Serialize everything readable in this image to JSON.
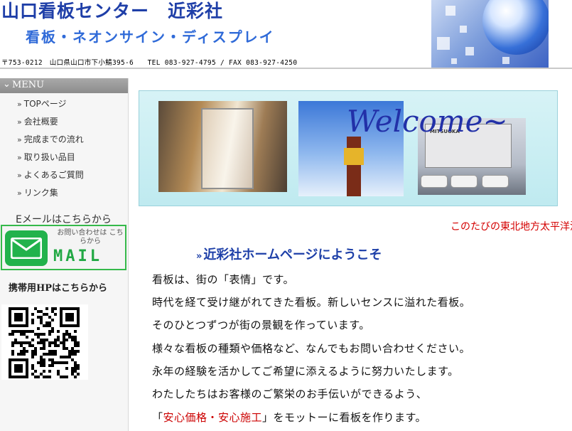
{
  "header": {
    "title": "山口看板センター　近彩社",
    "subtitle": "看板・ネオンサイン・ディスプレイ",
    "address": "〒753-0212　山口県山口市下小鯖395-6　　TEL 083-927-4795 / FAX 083-927-4250"
  },
  "sidebar": {
    "menu_title": "MENU",
    "items": [
      {
        "label": "TOPページ"
      },
      {
        "label": "会社概要"
      },
      {
        "label": "完成までの流れ"
      },
      {
        "label": "取り扱い品目"
      },
      {
        "label": "よくあるご質問"
      },
      {
        "label": "リンク集"
      }
    ],
    "email_label": "Eメールはこちらから",
    "mail_note": "お問い合わせは こちらから",
    "mail_word": "MAIL",
    "mobile_label": "携帯用HPはこちらから"
  },
  "main": {
    "banner_text": "Welcome~",
    "building_sign": "MITSUOKA",
    "ticker": "このたびの東北地方太平洋沖地震",
    "heading_mark": "»",
    "heading": "近彩社ホームページにようこそ",
    "paragraphs": [
      "看板は、街の「表情」です。",
      "時代を経て受け継がれてきた看板。新しいセンスに溢れた看板。",
      "そのひとつずつが街の景観を作っています。",
      "様々な看板の種類や価格など、なんでもお問い合わせください。",
      "永年の経験を活かしてご希望に添えるように努力いたします。",
      "わたしたちはお客様のご繁栄のお手伝いができるよう、"
    ],
    "motto_open": "「",
    "motto": "安心価格・安心施工",
    "motto_close": "」をモットーに看板を作ります。"
  },
  "colors": {
    "title_blue": "#1f3fa8",
    "mail_green": "#22b24c",
    "ticker_red": "#d40000"
  },
  "icons": [
    "chevron-down-icon",
    "arrow-icon",
    "envelope-icon",
    "qr-code-icon"
  ]
}
